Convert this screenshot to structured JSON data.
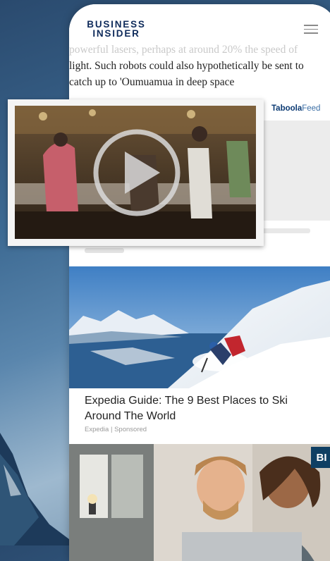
{
  "header": {
    "logo_line1": "BUSINESS",
    "logo_line2": "INSIDER"
  },
  "article": {
    "faded_line": "powerful lasers, perhaps at around 20% the speed of",
    "text": "light. Such robots could also hypothetically be sent to catch up to 'Oumuamua in deep space"
  },
  "taboola": {
    "brand": "Taboola",
    "feed": "Feed"
  },
  "card1": {
    "title": "Expedia Guide: The 9 Best Places to Ski Around The World",
    "source": "Expedia",
    "sponsored": "Sponsored",
    "separator": "|"
  },
  "card2": {
    "badge": "BI"
  },
  "colors": {
    "brand_navy": "#0f2b5b",
    "taboola_blue": "#0b3a73",
    "badge_bg": "#0f3f63"
  }
}
